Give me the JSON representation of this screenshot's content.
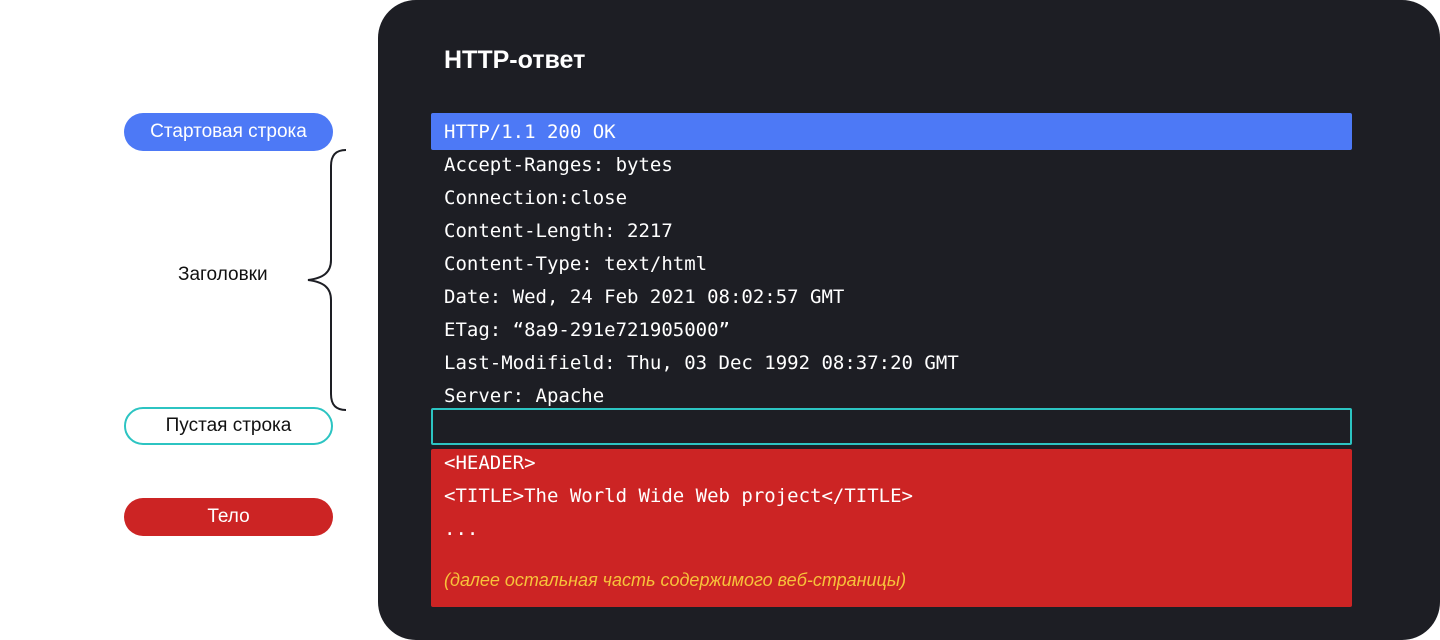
{
  "labels": {
    "start_line": "Стартовая строка",
    "headers": "Заголовки",
    "empty_line": "Пустая строка",
    "body": "Тело"
  },
  "panel": {
    "title": "HTTP-ответ",
    "start_line": "HTTP/1.1 200 OK",
    "headers": [
      "Accept-Ranges: bytes",
      "Connection:close",
      "Content-Length: 2217",
      "Content-Type: text/html",
      "Date: Wed, 24 Feb 2021 08:02:57 GMT",
      "ETag: “8a9-291e721905000”",
      "Last-Modifield: Thu, 03 Dec 1992 08:37:20 GMT",
      "Server: Apache"
    ],
    "body_lines": [
      "<HEADER>",
      "<TITLE>The World Wide Web project</TITLE>",
      "..."
    ],
    "body_note": "(далее остальная часть содержимого веб-страницы)"
  },
  "colors": {
    "panel_bg": "#1d1e24",
    "start_line": "#4d79f6",
    "empty_line_border": "#2cc4c2",
    "body": "#cc2424",
    "note_text": "#f7c23a"
  }
}
